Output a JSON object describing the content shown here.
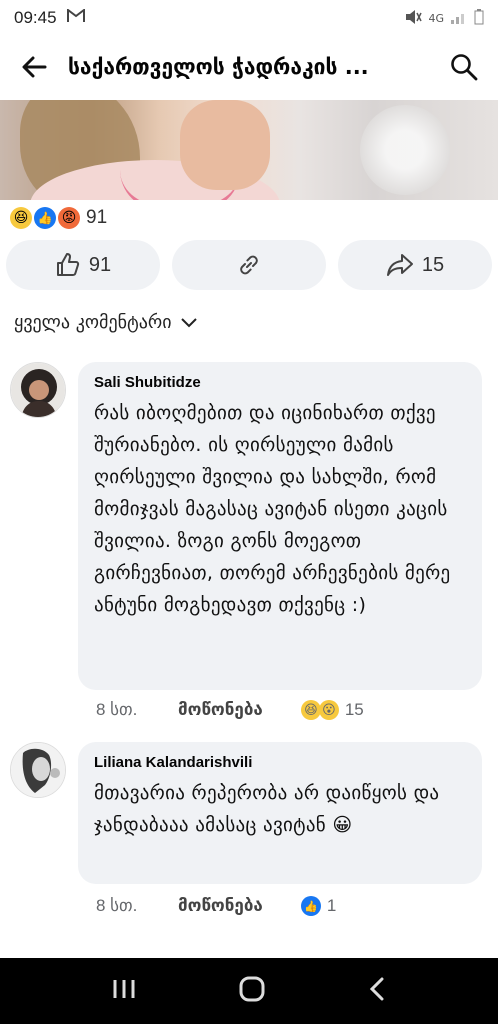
{
  "status": {
    "time": "09:45",
    "network": "4G"
  },
  "header": {
    "title": "საქართველოს ჭადრაკის ..."
  },
  "post": {
    "reaction_count": "91",
    "like_count": "91",
    "share_count": "15"
  },
  "sort_label": "ყველა კომენტარი",
  "comments": [
    {
      "author": "Sali Shubitidze",
      "text": "რას იბოღმებით და იცინიხართ თქვე შურიანებო. ის ღირსეული მამის ღირსეული შვილია და სახლში, რომ მომიჯვას მაგასაც ავიტან ისეთი კაცის შვილია. ზოგი გონს მოეგოთ გირჩევნიათ, თორემ არჩევნების მერე ანტუნი მოგხედავთ თქვენც :)",
      "time": "8 სთ.",
      "like_label": "მოწონება",
      "reaction_count": "15"
    },
    {
      "author": "Liliana Kalandarishvili",
      "text": "მთავარია რეპერობა არ დაიწყოს და ჯანდაბააა ამასაც ავიტან 😀",
      "time": "8 სთ.",
      "like_label": "მოწონება",
      "reaction_count": "1"
    }
  ],
  "colors": {
    "accent": "#1877f2",
    "bubble": "#f0f2f5",
    "meta": "#65676b"
  }
}
